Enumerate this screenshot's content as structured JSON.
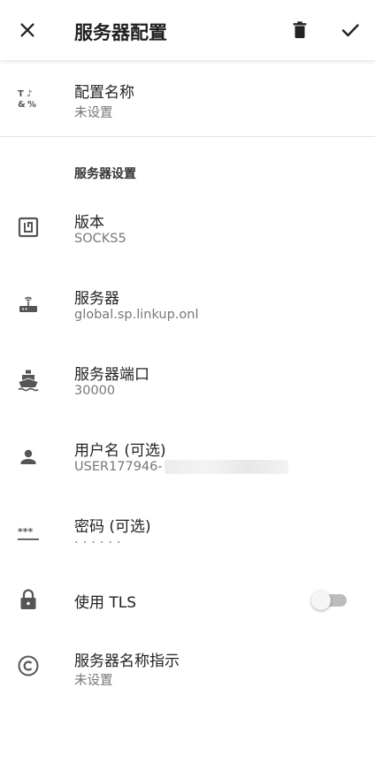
{
  "appbar": {
    "title": "服务器配置",
    "close_icon": "close-icon",
    "delete_icon": "trash-icon",
    "confirm_icon": "check-icon"
  },
  "profile": {
    "label": "配置名称",
    "value": "未设置",
    "icon": "text-format-icon"
  },
  "section_title": "服务器设置",
  "settings": {
    "version": {
      "label": "版本",
      "value": "SOCKS5",
      "icon": "nfc-icon"
    },
    "server": {
      "label": "服务器",
      "value": "global.sp.linkup.onl",
      "icon": "router-icon"
    },
    "port": {
      "label": "服务器端口",
      "value": "30000",
      "icon": "ship-icon"
    },
    "username": {
      "label": "用户名 (可选)",
      "value": "USER177946-",
      "icon": "person-icon"
    },
    "password": {
      "label": "密码 (可选)",
      "value": "······",
      "icon": "password-icon"
    },
    "tls": {
      "label": "使用 TLS",
      "enabled": false,
      "icon": "lock-icon"
    },
    "sni": {
      "label": "服务器名称指示",
      "value": "未设置",
      "icon": "copyright-icon"
    }
  },
  "colors": {
    "background": "#ffffff",
    "icon": "#555555",
    "toggle_off_track": "#bdbdbd"
  }
}
